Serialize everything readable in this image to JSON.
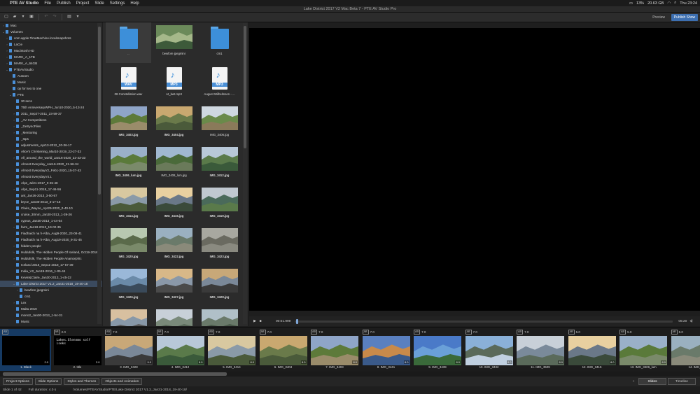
{
  "menubar": {
    "app": "PTE AV Studio",
    "items": [
      "File",
      "Publish",
      "Project",
      "Slide",
      "Settings",
      "Help"
    ],
    "battery": "13%",
    "memory": "20.63 GB",
    "clock": "Thu 23:24"
  },
  "window": {
    "title": "Lake District 2017 V2 Mac Beta 7 - PTE AV Studio Pro"
  },
  "toolbar": {
    "preview": "Preview",
    "publish": "Publish Show"
  },
  "tree": [
    {
      "label": "Mac",
      "d": 0,
      "a": "›"
    },
    {
      "label": "Volumes",
      "d": 0,
      "a": "⌄"
    },
    {
      "label": "com.apple.TimeMachine.localsnapshots",
      "d": 1,
      "a": "›"
    },
    {
      "label": "LaCie",
      "d": 1,
      "a": "›"
    },
    {
      "label": "Macintosh HD",
      "d": 1,
      "a": "›"
    },
    {
      "label": "MARK_A_1TB",
      "d": 1,
      "a": "›"
    },
    {
      "label": "MARK_A_64GB",
      "d": 1,
      "a": "›"
    },
    {
      "label": "PTEAVStudio",
      "d": 1,
      "a": "⌄"
    },
    {
      "label": "Autoom",
      "d": 2,
      "a": ""
    },
    {
      "label": "Music",
      "d": 2,
      "a": ""
    },
    {
      "label": "op for two to one",
      "d": 2,
      "a": ""
    },
    {
      "label": "PTE",
      "d": 2,
      "a": "⌄"
    },
    {
      "label": "30 secs",
      "d": 3,
      "a": ""
    },
    {
      "label": "75th AnniversaryWPH_Jun10-2020_5-13-24",
      "d": 3,
      "a": ""
    },
    {
      "label": "2011_Sep27-2011_23-59-37",
      "d": 3,
      "a": "›"
    },
    {
      "label": "_AV Competitions",
      "d": 3,
      "a": "›"
    },
    {
      "label": "_DeSyncFiles",
      "d": 3,
      "a": "›"
    },
    {
      "label": "_Mentoring",
      "d": 3,
      "a": "›"
    },
    {
      "label": "_stps",
      "d": 3,
      "a": ""
    },
    {
      "label": "adjustments_Apr13-2012_20-36-17",
      "d": 3,
      "a": ""
    },
    {
      "label": "Alice's Christening_Mar10-2019_22-27-33",
      "d": 3,
      "a": ""
    },
    {
      "label": "All_around_the_world_Jan16-2020_22-43-33",
      "d": 3,
      "a": "›"
    },
    {
      "label": "Almost Everyday_Jan16-2020_21-56-34",
      "d": 3,
      "a": ""
    },
    {
      "label": "Almost EverydayV2_Feb1-2020_15-37-43",
      "d": 3,
      "a": ""
    },
    {
      "label": "Almost EverydayV4.1",
      "d": 3,
      "a": ""
    },
    {
      "label": "Alps_Jul21-2017_0-45-48",
      "d": 3,
      "a": ""
    },
    {
      "label": "Alps_Sep11-2018_17-46-56",
      "d": 3,
      "a": "›"
    },
    {
      "label": "ant_Jan26-2013_3-50-57",
      "d": 3,
      "a": ""
    },
    {
      "label": "bryce_Jan30-2013_3-17-15",
      "d": 3,
      "a": ""
    },
    {
      "label": "Claire_Wayne_Apr29-2020_0-40-10",
      "d": 3,
      "a": ""
    },
    {
      "label": "cruise_30mm_Jan30-2013_1-39-26",
      "d": 3,
      "a": ""
    },
    {
      "label": "cyprus_Jan30-2013_1-44-04",
      "d": 3,
      "a": ""
    },
    {
      "label": "farm_Jan18-2013_19-02-35",
      "d": 3,
      "a": "›"
    },
    {
      "label": "Fiadhaich na h-Alba_Aug9-2020_23-08-41",
      "d": 3,
      "a": ""
    },
    {
      "label": "Fiadhaich na h-Alba_Aug19-2020_9-31-45",
      "d": 3,
      "a": ""
    },
    {
      "label": "hidden people",
      "d": 3,
      "a": "›"
    },
    {
      "label": "Huldufolk, The Hidden People Of Iceland, Oct19-2016",
      "d": 3,
      "a": "›"
    },
    {
      "label": "Huldufolk, The Hidden People Anamorphic",
      "d": 3,
      "a": "›"
    },
    {
      "label": "Iceland 2016_Sep11-2018_17-57-39",
      "d": 3,
      "a": ""
    },
    {
      "label": "India_V2_Jun19-2016_1-05-44",
      "d": 3,
      "a": ""
    },
    {
      "label": "Kevin&Claire_Jan30-2013_1-45-22",
      "d": 3,
      "a": ""
    },
    {
      "label": "Lake District 2017 V1.2_Jan31-2018_19-40-18",
      "d": 3,
      "a": "⌄",
      "sel": true
    },
    {
      "label": "bewfore jpegmini",
      "d": 4,
      "a": "›"
    },
    {
      "label": "cm1",
      "d": 4,
      "a": ""
    },
    {
      "label": "Lex",
      "d": 3,
      "a": "›"
    },
    {
      "label": "Malta 2019",
      "d": 3,
      "a": ""
    },
    {
      "label": "mono2_Jan30-2013_1-54-31",
      "d": 3,
      "a": ""
    },
    {
      "label": "Music",
      "d": 3,
      "a": ""
    },
    {
      "label": "Music_V2_Jan30-2013_1-54-31",
      "d": 3,
      "a": ""
    }
  ],
  "files": [
    {
      "type": "folder",
      "label": "..",
      "sel": true
    },
    {
      "type": "photo",
      "label": "bewfore jpegmini",
      "scene": 1
    },
    {
      "type": "folder",
      "label": "cm1"
    },
    {
      "type": "audio",
      "label": "08 Constellation.wav",
      "ext": "WAV"
    },
    {
      "type": "audio",
      "label": "At_last.mp3",
      "ext": "MP3"
    },
    {
      "type": "audio",
      "label": "August Wilhelmson - ...",
      "ext": "MP3"
    },
    {
      "type": "photo",
      "label": "IMG_3403.jpg",
      "bold": true,
      "scene": 2
    },
    {
      "type": "photo",
      "label": "IMG_3404.jpg",
      "bold": true,
      "scene": 3
    },
    {
      "type": "photo",
      "label": "IMG_3406.jpg",
      "scene": 4
    },
    {
      "type": "photo",
      "label": "IMG_3406_lum.jpg",
      "bold": true,
      "scene": 5
    },
    {
      "type": "photo",
      "label": "IMG_3408_lum.jpg",
      "scene": 6
    },
    {
      "type": "photo",
      "label": "IMG_3412.jpg",
      "bold": true,
      "scene": 7
    },
    {
      "type": "photo",
      "label": "IMG_3414.jpg",
      "bold": true,
      "scene": 8
    },
    {
      "type": "photo",
      "label": "IMG_3415.jpg",
      "bold": true,
      "scene": 9
    },
    {
      "type": "photo",
      "label": "IMG_3419.jpg",
      "bold": true,
      "scene": 10
    },
    {
      "type": "photo",
      "label": "IMG_3420.jpg",
      "bold": true,
      "scene": 11
    },
    {
      "type": "photo",
      "label": "IMG_3422.jpg",
      "bold": true,
      "scene": 12
    },
    {
      "type": "photo",
      "label": "IMG_3423.jpg",
      "bold": true,
      "scene": 13
    },
    {
      "type": "photo",
      "label": "IMG_3426.jpg",
      "bold": true,
      "scene": 14
    },
    {
      "type": "photo",
      "label": "IMG_3427.jpg",
      "bold": true,
      "scene": 15
    },
    {
      "type": "photo",
      "label": "IMG_3428.jpg",
      "bold": true,
      "scene": 16
    },
    {
      "type": "photo",
      "label": "",
      "scene": 17
    },
    {
      "type": "photo",
      "label": "",
      "scene": 18
    },
    {
      "type": "photo",
      "label": "",
      "scene": 19
    }
  ],
  "player": {
    "time": "00:01.999",
    "end": "05:20"
  },
  "slides": [
    {
      "num": "1. Blank",
      "dur": "2.0",
      "ab": "AB",
      "hd": "",
      "scene": 0
    },
    {
      "num": "2. title",
      "dur": "2.0",
      "ab": "AB",
      "hd": "2.0",
      "scene": -1,
      "titleText": "Lakes.Glennmo solf iseks"
    },
    {
      "num": "3. IMG_3428",
      "dur": "9.0",
      "ab": "AB",
      "hd": "7.0",
      "scene": 16
    },
    {
      "num": "4. IMG_3412",
      "dur": "8.0",
      "ab": "AB",
      "hd": "7.0",
      "scene": 7
    },
    {
      "num": "5. IMG_3414",
      "dur": "8.0",
      "ab": "AB",
      "hd": "7.0",
      "scene": 8
    },
    {
      "num": "6. IMG_3404",
      "dur": "8.0",
      "ab": "AB",
      "hd": "7.0",
      "scene": 3
    },
    {
      "num": "7. IMG_3403",
      "dur": "8.0",
      "ab": "AB",
      "hd": "7.0",
      "scene": 2
    },
    {
      "num": "8. IMG_3441",
      "dur": "8.0",
      "ab": "AB",
      "hd": "7.0",
      "scene": 20
    },
    {
      "num": "9. IMG_3439",
      "dur": "8.0",
      "ab": "AB",
      "hd": "7.0",
      "scene": 21
    },
    {
      "num": "10. IMG_3432",
      "dur": "8.0",
      "ab": "AB",
      "hd": "7.0",
      "scene": 22
    },
    {
      "num": "11. IMG_3509",
      "dur": "8.0",
      "ab": "AB",
      "hd": "7.0",
      "scene": 23
    },
    {
      "num": "12. IMG_3415",
      "dur": "8.0",
      "ab": "AB",
      "hd": "5.0",
      "scene": 9
    },
    {
      "num": "13. IMG_3406_lum",
      "dur": "8.0",
      "ab": "AB",
      "hd": "5.0",
      "scene": 5
    },
    {
      "num": "14. IMG_",
      "dur": "",
      "ab": "AB",
      "hd": "5.0",
      "scene": 12
    }
  ],
  "bottom": {
    "buttons": [
      "Project Options",
      "Slide Options",
      "Styles and Themes",
      "Objects and Animation"
    ],
    "tabs": [
      "Slides",
      "Timeline"
    ]
  },
  "status": {
    "slide": "Slide 1 of 42",
    "duration": "Full duration: 4.0 s",
    "path": "/Volumes/PTEAVStudio/PTE/Lake District 2017 V1.2_Jan31-2018_19-40-18/"
  }
}
